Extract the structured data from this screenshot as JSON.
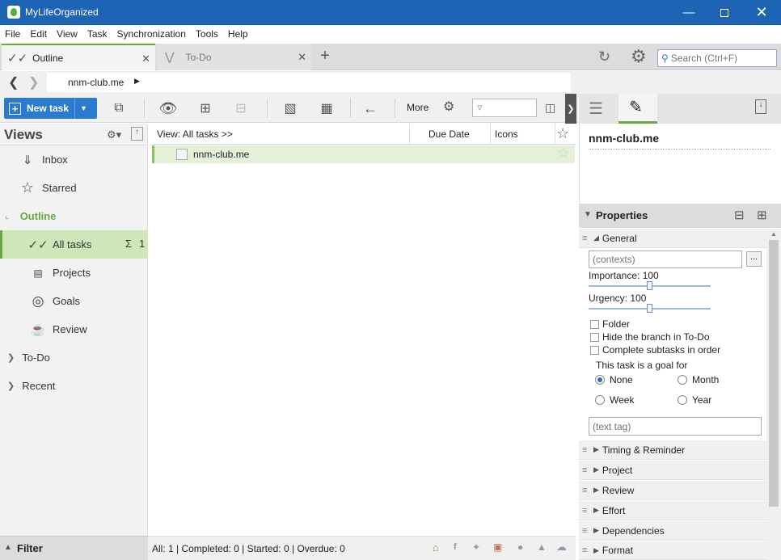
{
  "app": {
    "title": "MyLifeOrganized"
  },
  "menu": [
    "File",
    "Edit",
    "View",
    "Task",
    "Synchronization",
    "Tools",
    "Help"
  ],
  "tabs": [
    {
      "label": "Outline",
      "active": true
    },
    {
      "label": "To-Do",
      "active": false
    }
  ],
  "search": {
    "placeholder": "Search (Ctrl+F)"
  },
  "breadcrumb": {
    "item": "nnm-club.me"
  },
  "toolbar": {
    "new_task": "New task",
    "more": "More"
  },
  "views": {
    "title": "Views",
    "items": [
      {
        "label": "Inbox",
        "icon": "inbox-icon"
      },
      {
        "label": "Starred",
        "icon": "star-icon"
      },
      {
        "label": "Outline",
        "icon": "collapse-icon"
      },
      {
        "label": "All tasks",
        "icon": "checks-icon",
        "count": "1",
        "sum": "Σ"
      },
      {
        "label": "Projects",
        "icon": "projects-icon"
      },
      {
        "label": "Goals",
        "icon": "target-icon"
      },
      {
        "label": "Review",
        "icon": "cup-icon"
      },
      {
        "label": "To-Do",
        "icon": "expand-icon"
      },
      {
        "label": "Recent",
        "icon": "expand-icon"
      }
    ],
    "filter": "Filter"
  },
  "grid": {
    "view_label": "View: All tasks >>",
    "columns": [
      "Due Date",
      "Icons"
    ],
    "rows": [
      {
        "title": "nnm-club.me"
      }
    ]
  },
  "status": {
    "text": "All: 1 | Completed: 0 | Started: 0 | Overdue: 0"
  },
  "task_panel": {
    "title": "nnm-club.me",
    "properties": "Properties",
    "general": "General",
    "contexts_placeholder": "(contexts)",
    "importance": "Importance: 100",
    "importance_value": 100,
    "urgency": "Urgency: 100",
    "urgency_value": 100,
    "checkboxes": [
      "Folder",
      "Hide the branch in To-Do",
      "Complete subtasks in order"
    ],
    "goal_label": "This task is a goal for",
    "goal_options": [
      "None",
      "Month",
      "Week",
      "Year"
    ],
    "goal_selected": "None",
    "text_tag_placeholder": "(text tag)",
    "sections": [
      "Timing & Reminder",
      "Project",
      "Review",
      "Effort",
      "Dependencies",
      "Format"
    ]
  },
  "colors": {
    "titlebar": "#1e64b4",
    "accent_green": "#6aa843",
    "new_task_blue": "#2a7bd0"
  }
}
